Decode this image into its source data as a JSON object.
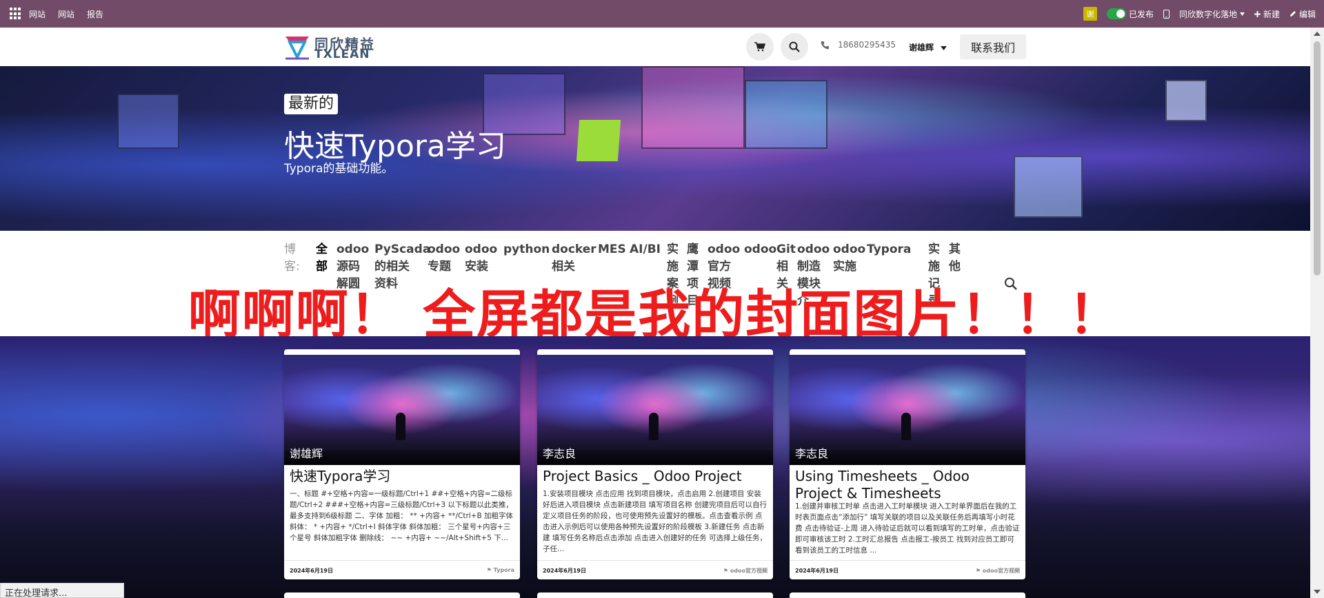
{
  "adminbar": {
    "menu": [
      "网站",
      "网站",
      "报告"
    ],
    "avatar_initial": "谢",
    "published_label": "已发布",
    "site_label": "同欣数字化落地",
    "new_label": "新建",
    "edit_label": "编辑"
  },
  "header": {
    "logo_cn": "同欣精益",
    "logo_en": "TXLEAN",
    "phone": "18680295435",
    "user": "谢雄辉",
    "contact_label": "联系我们"
  },
  "hero": {
    "badge": "最新的",
    "title": "快速Typora学习",
    "subtitle": "Typora的基础功能。"
  },
  "filter": {
    "label": [
      "博",
      "客:"
    ],
    "items": [
      {
        "lines": [
          "全",
          "部"
        ]
      },
      {
        "lines": [
          "odoo",
          "源码",
          "解圆"
        ]
      },
      {
        "lines": [
          "PyScada",
          "的相关",
          "资料"
        ]
      },
      {
        "lines": [
          "odoo",
          "专题"
        ]
      },
      {
        "lines": [
          "odoo",
          "安装"
        ]
      },
      {
        "lines": [
          "python"
        ]
      },
      {
        "lines": [
          "docker",
          "相关"
        ]
      },
      {
        "lines": [
          "MES"
        ]
      },
      {
        "lines": [
          "AI/BI"
        ]
      },
      {
        "lines": [
          "实",
          "施",
          "案",
          "例"
        ]
      },
      {
        "lines": [
          "鹰",
          "潭",
          "项",
          "目"
        ]
      },
      {
        "lines": [
          "odoo",
          "官方",
          "视频"
        ]
      },
      {
        "lines": [
          "odoo"
        ]
      },
      {
        "lines": [
          "Git",
          "相",
          "关"
        ]
      },
      {
        "lines": [
          "odoo",
          "制造",
          "模块",
          "介"
        ]
      },
      {
        "lines": [
          "odoo",
          "实施"
        ]
      },
      {
        "lines": [
          "Typora"
        ]
      },
      {
        "lines": [
          "实",
          "施",
          "记",
          "录"
        ]
      },
      {
        "lines": [
          "其",
          "他"
        ]
      }
    ]
  },
  "overlay_text": "啊啊啊！ 全屏都是我的封面图片！！！",
  "cards": [
    {
      "author": "谢雄辉",
      "title": "快速Typora学习",
      "excerpt": "一、标题 #+空格+内容=一级标题/Ctrl+1 ##+空格+内容=二级标题/Ctrl+2 ###+空格+内容=三级标题/Ctrl+3 以下标题以此类推，最多支持到6级标题 二、字体 加粗： ** +内容+ **/Ctrl+B 加粗字体 斜体： * +内容+ */Ctrl+I 斜体字体 斜体加粗： 三个星号+内容+三个星号 斜体加粗字体 删除线： ~~ +内容+ ~~/Alt+Shift+5 下...",
      "date": "2024年6月19日",
      "tag": "Typora"
    },
    {
      "author": "李志良",
      "title": "Project Basics _ Odoo Project",
      "excerpt": "1.安装项目模块 点击应用 找到项目模块，点击启用 2.创建项目 安装好后进入项目模块 点击新建项目 填写项目名称 创建完项目后可以自行定义项目任务的阶段，也可使用预先设置好的模板。点击查看示例 点击进入示例后可以使用各种预先设置好的阶段模板 3.新建任务 点击新建 填写任务名称后点击添加 点击进入创建好的任务 可选择上级任务，子任...",
      "date": "2024年6月19日",
      "tag": "odoo官方视频"
    },
    {
      "author": "李志良",
      "title": "Using Timesheets _ Odoo Project & Timesheets",
      "excerpt": "1.创建并审核工时单 点击进入工时单模块 进入工时单界面后在我的工时表页面点击“添加行” 填写关联的项目以及关联任务后再填写小时花费 点击待验证-上周 进入待验证后就可以看到填写的工时单，点击验证即可审核该工时 2.工时汇总报告 点击报工-按员工 找到对应员工即可看到该员工的工时信息 ...",
      "date": "2024年6月19日",
      "tag": "odoo官方视频"
    }
  ],
  "status_text": "正在处理请求..."
}
